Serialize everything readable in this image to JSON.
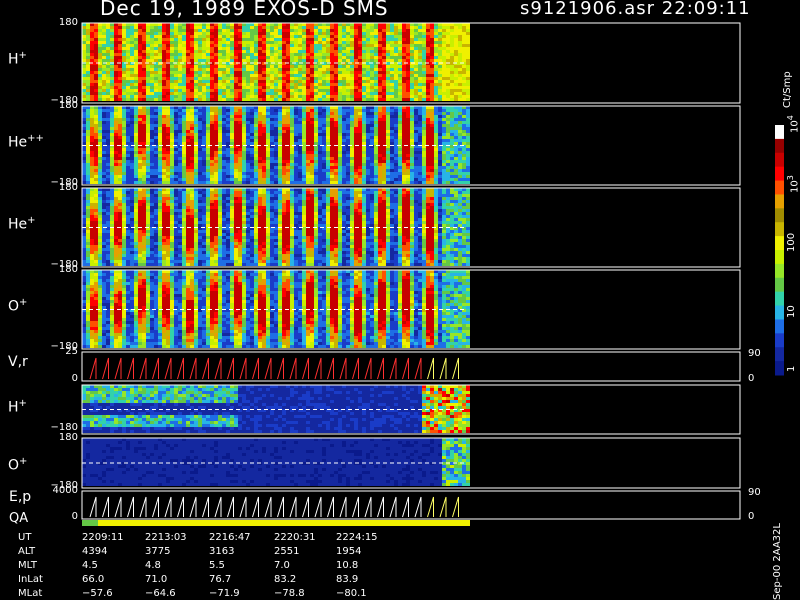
{
  "header": {
    "title": "Dec 19, 1989    EXOS-D SMS",
    "file_time": "s9121906.asr  22:09:11"
  },
  "colorbar": {
    "unit_label": "Ct/Smp",
    "tick_labels": [
      "1",
      "10",
      "100",
      "10",
      "3",
      "10",
      "4"
    ],
    "ticks": [
      {
        "text": "1",
        "exp": ""
      },
      {
        "text": "10",
        "exp": ""
      },
      {
        "text": "100",
        "exp": ""
      },
      {
        "text": "10",
        "exp": "3"
      },
      {
        "text": "10",
        "exp": "4"
      }
    ],
    "colors": [
      "#0a1a8c",
      "#1428a0",
      "#1a3cc8",
      "#1e6ee6",
      "#28b4e6",
      "#32d2aa",
      "#64c846",
      "#96e628",
      "#c8f000",
      "#f0f000",
      "#c8b400",
      "#a08c00",
      "#e6a000",
      "#ff5000",
      "#ff0000",
      "#c80000",
      "#960000",
      "#ffffff"
    ]
  },
  "panels": [
    {
      "id": "h-plus",
      "label": "H",
      "sup": "+",
      "ticks": [
        "180",
        "−180"
      ]
    },
    {
      "id": "he-pp",
      "label": "He",
      "sup": "++",
      "ticks": [
        "180",
        "−180"
      ]
    },
    {
      "id": "he-plus",
      "label": "He",
      "sup": "+",
      "ticks": [
        "180",
        "−180"
      ]
    },
    {
      "id": "o-plus",
      "label": "O",
      "sup": "+",
      "ticks": [
        "180",
        "−180"
      ]
    },
    {
      "id": "vr",
      "label": "V,r",
      "sup": "",
      "ticks": [
        "25",
        "0"
      ],
      "right_ticks": [
        "90",
        "0"
      ]
    },
    {
      "id": "h-plus-2",
      "label": "H",
      "sup": "+",
      "ticks": [
        "−180"
      ]
    },
    {
      "id": "o-plus-2",
      "label": "O",
      "sup": "+",
      "ticks": [
        "180",
        "−180"
      ]
    },
    {
      "id": "ep",
      "label": "E,p",
      "sup": "",
      "ticks": [
        "4000",
        "0"
      ],
      "right_ticks": [
        "90",
        "0"
      ]
    }
  ],
  "qa_label": "QA",
  "ephemeris": {
    "rows": [
      {
        "name": "UT",
        "values": [
          "2209:11",
          "2213:03",
          "2216:47",
          "2220:31",
          "2224:15"
        ]
      },
      {
        "name": "ALT",
        "values": [
          "4394",
          "3775",
          "3163",
          "2551",
          "1954"
        ]
      },
      {
        "name": "MLT",
        "values": [
          "4.5",
          "4.8",
          "5.5",
          "7.0",
          "10.8"
        ]
      },
      {
        "name": "InLat",
        "values": [
          "66.0",
          "71.0",
          "76.7",
          "83.2",
          "83.9"
        ]
      },
      {
        "name": "MLat",
        "values": [
          "−57.6",
          "−64.6",
          "−71.9",
          "−78.8",
          "−80.1"
        ]
      }
    ]
  },
  "footer_stamp": "Sep-00  2AA32L",
  "chart_data": {
    "type": "heatmap",
    "title": "Dec 19, 1989    EXOS-D SMS",
    "colorbar_label": "Ct/Smp",
    "colorbar_scale": "log",
    "colorbar_range": [
      1,
      10000
    ],
    "x_tick_labels": [
      "2209:11",
      "2213:03",
      "2216:47",
      "2220:31",
      "2224:15"
    ],
    "panels": [
      {
        "species": "H+",
        "ylim": [
          -180,
          180
        ]
      },
      {
        "species": "He++",
        "ylim": [
          -180,
          180
        ]
      },
      {
        "species": "He+",
        "ylim": [
          -180,
          180
        ]
      },
      {
        "species": "O+",
        "ylim": [
          -180,
          180
        ]
      },
      {
        "species": "V,r",
        "ylim": [
          0,
          25
        ],
        "right_ylim": [
          0,
          90
        ]
      },
      {
        "species": "H+",
        "ylim": [
          -180,
          180
        ]
      },
      {
        "species": "O+",
        "ylim": [
          -180,
          180
        ]
      },
      {
        "species": "E,p",
        "ylim": [
          0,
          4000
        ],
        "right_ylim": [
          0,
          90
        ]
      }
    ]
  }
}
